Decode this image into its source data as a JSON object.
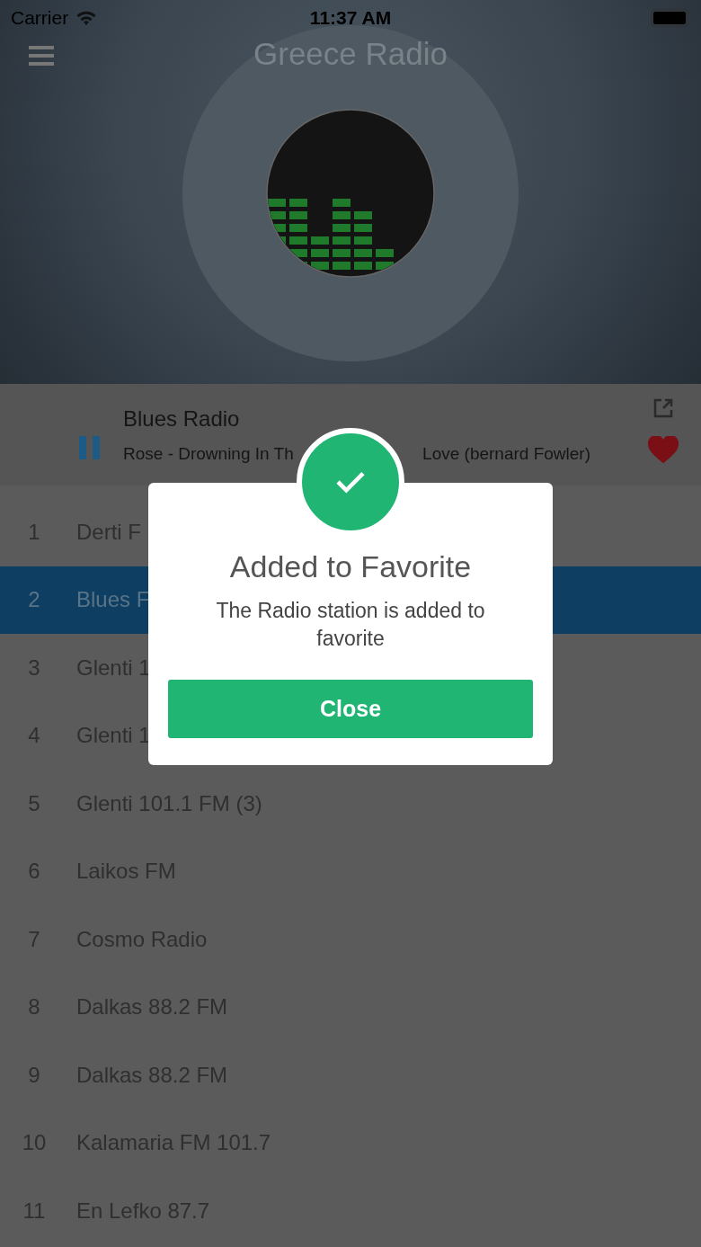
{
  "status_bar": {
    "carrier": "Carrier",
    "time": "11:37 AM"
  },
  "header": {
    "title": "Greece Radio"
  },
  "now_playing": {
    "station": "Blues Radio",
    "track_parts": [
      "Rose - Drowning In Th",
      "Love (bernard Fowler)"
    ],
    "playing": true,
    "favorite": true
  },
  "stations": [
    {
      "number": "1",
      "name": "Derti F",
      "selected": false
    },
    {
      "number": "2",
      "name": "Blues F",
      "selected": true
    },
    {
      "number": "3",
      "name": "Glenti 1",
      "selected": false
    },
    {
      "number": "4",
      "name": "Glenti 1",
      "selected": false
    },
    {
      "number": "5",
      "name": "Glenti 101.1 FM (3)",
      "selected": false
    },
    {
      "number": "6",
      "name": "Laikos FM",
      "selected": false
    },
    {
      "number": "7",
      "name": "Cosmo Radio",
      "selected": false
    },
    {
      "number": "8",
      "name": "Dalkas 88.2 FM",
      "selected": false
    },
    {
      "number": "9",
      "name": "Dalkas 88.2 FM",
      "selected": false
    },
    {
      "number": "10",
      "name": "Kalamaria FM 101.7",
      "selected": false
    },
    {
      "number": "11",
      "name": "En Lefko 87.7",
      "selected": false
    }
  ],
  "dialog": {
    "title": "Added to Favorite",
    "message": "The Radio station is added to favorite",
    "button": "Close"
  }
}
